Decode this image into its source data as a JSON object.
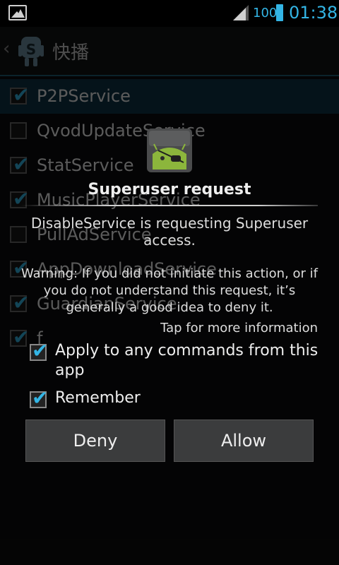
{
  "status_bar": {
    "battery_level": "100",
    "time": "01:38"
  },
  "action_bar": {
    "title": "快播"
  },
  "services": [
    {
      "label": "P2PService",
      "checked": true
    },
    {
      "label": "QvodUpdateService",
      "checked": false
    },
    {
      "label": "StatService",
      "checked": true
    },
    {
      "label": "MusicPlayerService",
      "checked": true
    },
    {
      "label": "PullAdService",
      "checked": false
    },
    {
      "label": "AppDownloadService",
      "checked": true
    },
    {
      "label": "GuardianService",
      "checked": true
    },
    {
      "label": "f",
      "checked": true
    }
  ],
  "dialog": {
    "title": "Superuser request",
    "message": "DisableService is requesting Superuser access.",
    "warning": "Warning: If you did not initiate this action, or if you do not understand this request, it’s generally a good idea to deny it.",
    "more_info": "Tap for more information",
    "option_apply_all": "Apply to any commands from this app",
    "option_remember": "Remember",
    "deny_label": "Deny",
    "allow_label": "Allow"
  },
  "colors": {
    "accent": "#33b5e5",
    "android_green": "#8cb63c"
  }
}
